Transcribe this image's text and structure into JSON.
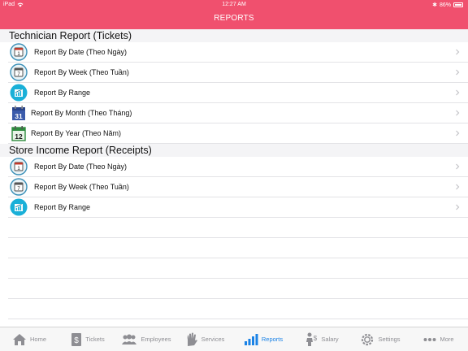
{
  "status_bar": {
    "device": "iPad",
    "time": "12:27 AM",
    "battery": "86%"
  },
  "nav": {
    "title": "REPORTS"
  },
  "sections": [
    {
      "title": "Technician Report (Tickets)",
      "items": [
        {
          "label": "Report By Date (Theo Ngày)",
          "icon": "calendar-day-icon"
        },
        {
          "label": "Report By Week (Theo Tuần)",
          "icon": "calendar-week-icon"
        },
        {
          "label": "Report By Range",
          "icon": "chart-range-icon"
        },
        {
          "label": "Report By Month (Theo Tháng)",
          "icon": "calendar-month-icon",
          "icon_text": "31"
        },
        {
          "label": "Report By Year (Theo Năm)",
          "icon": "calendar-year-icon",
          "icon_text": "12"
        }
      ]
    },
    {
      "title": "Store Income Report (Receipts)",
      "items": [
        {
          "label": "Report By Date (Theo Ngày)",
          "icon": "calendar-day-icon"
        },
        {
          "label": "Report By Week (Theo Tuần)",
          "icon": "calendar-week-icon"
        },
        {
          "label": "Report By Range",
          "icon": "chart-range-icon"
        }
      ]
    }
  ],
  "tabs": [
    {
      "label": "Home",
      "icon": "home-icon"
    },
    {
      "label": "Tickets",
      "icon": "tickets-icon"
    },
    {
      "label": "Employees",
      "icon": "employees-icon"
    },
    {
      "label": "Services",
      "icon": "services-icon"
    },
    {
      "label": "Reports",
      "icon": "reports-icon",
      "active": true
    },
    {
      "label": "Salary",
      "icon": "salary-icon"
    },
    {
      "label": "Settings",
      "icon": "settings-icon"
    },
    {
      "label": "More",
      "icon": "more-icon"
    }
  ],
  "colors": {
    "brand": "#f0506e",
    "active_tab": "#1a82e6",
    "calendar_blue": "#3b5bab",
    "calendar_green": "#2e8b3e",
    "range_teal": "#1ab0d8"
  }
}
